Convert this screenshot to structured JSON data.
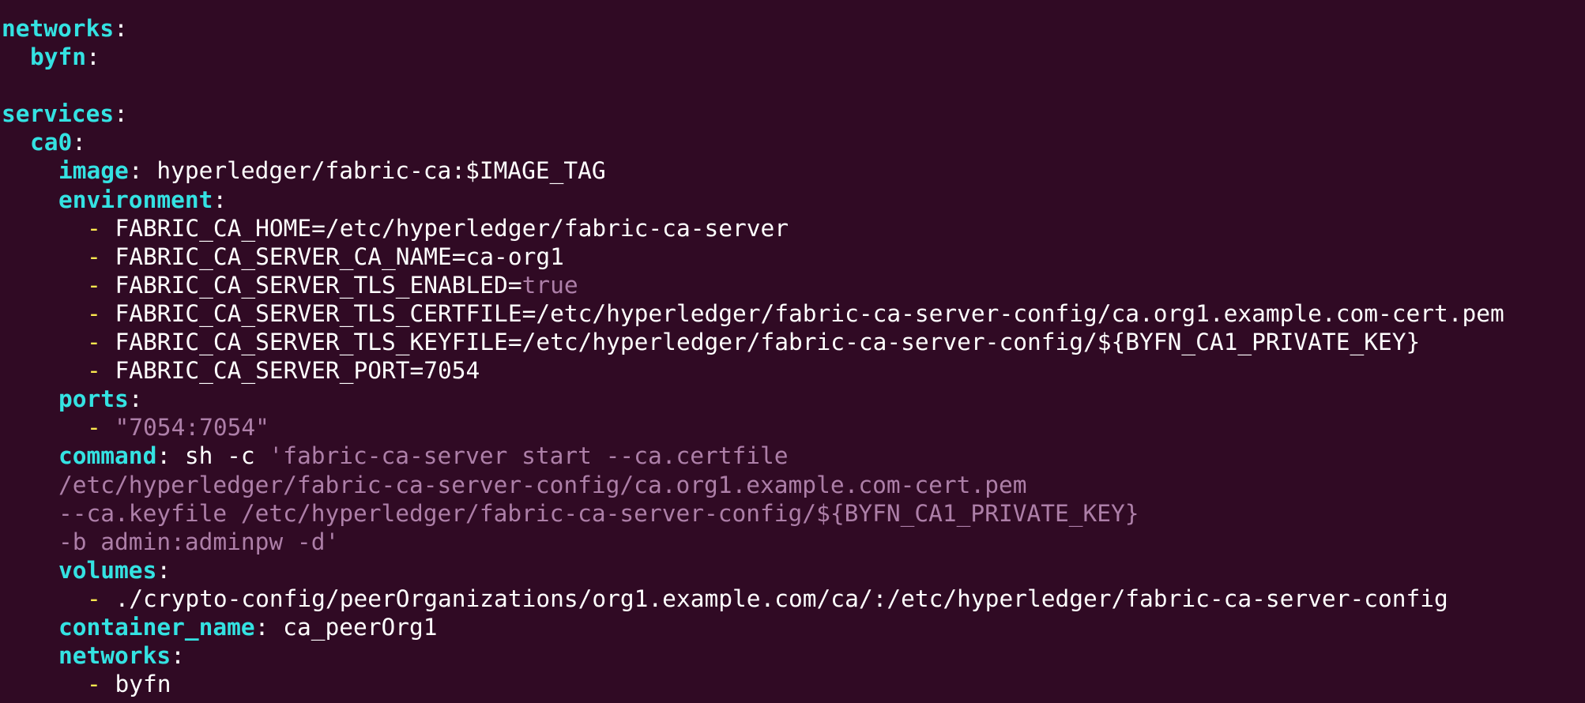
{
  "lines": [
    {
      "key": "networks",
      "sep": ":"
    },
    {
      "key": "byfn",
      "sep": ":"
    },
    {},
    {
      "key": "services",
      "sep": ":"
    },
    {
      "key": "ca0",
      "sep": ":"
    },
    {
      "key": "image",
      "sep": ":",
      "value": " hyperledger/fabric-ca:$IMAGE_TAG"
    },
    {
      "key": "environment",
      "sep": ":"
    },
    {
      "dash": "-",
      "value": " FABRIC_CA_HOME=/etc/hyperledger/fabric-ca-server"
    },
    {
      "dash": "-",
      "value": " FABRIC_CA_SERVER_CA_NAME=ca-org1"
    },
    {
      "dash": "-",
      "value": " FABRIC_CA_SERVER_TLS_ENABLED=",
      "literal": "true"
    },
    {
      "dash": "-",
      "value": " FABRIC_CA_SERVER_TLS_CERTFILE=/etc/hyperledger/fabric-ca-server-config/ca.org1.example.com-cert.pem"
    },
    {
      "dash": "-",
      "value": " FABRIC_CA_SERVER_TLS_KEYFILE=/etc/hyperledger/fabric-ca-server-config/${BYFN_CA1_PRIVATE_KEY}"
    },
    {
      "dash": "-",
      "value": " FABRIC_CA_SERVER_PORT=7054"
    },
    {
      "key": "ports",
      "sep": ":"
    },
    {
      "dash": "-",
      "string": " \"7054:7054\""
    },
    {
      "key": "command",
      "sep": ":",
      "value": " sh -c ",
      "string": "'fabric-ca-server start --ca.certfile"
    },
    {
      "string": "/etc/hyperledger/fabric-ca-server-config/ca.org1.example.com-cert.pem"
    },
    {
      "string": "--ca.keyfile /etc/hyperledger/fabric-ca-server-config/${BYFN_CA1_PRIVATE_KEY}"
    },
    {
      "string": "-b admin:adminpw -d'"
    },
    {
      "key": "volumes",
      "sep": ":"
    },
    {
      "dash": "-",
      "value": " ./crypto-config/peerOrganizations/org1.example.com/ca/:/etc/hyperledger/fabric-ca-server-config"
    },
    {
      "key": "container_name",
      "sep": ":",
      "value": " ca_peerOrg1"
    },
    {
      "key": "networks",
      "sep": ":"
    },
    {
      "dash": "-",
      "value": " byfn"
    }
  ],
  "colors": {
    "background": "#300a24",
    "key": "#34e2e2",
    "text": "#ffffff",
    "dash": "#fce94f",
    "string": "#ad7fa8"
  }
}
